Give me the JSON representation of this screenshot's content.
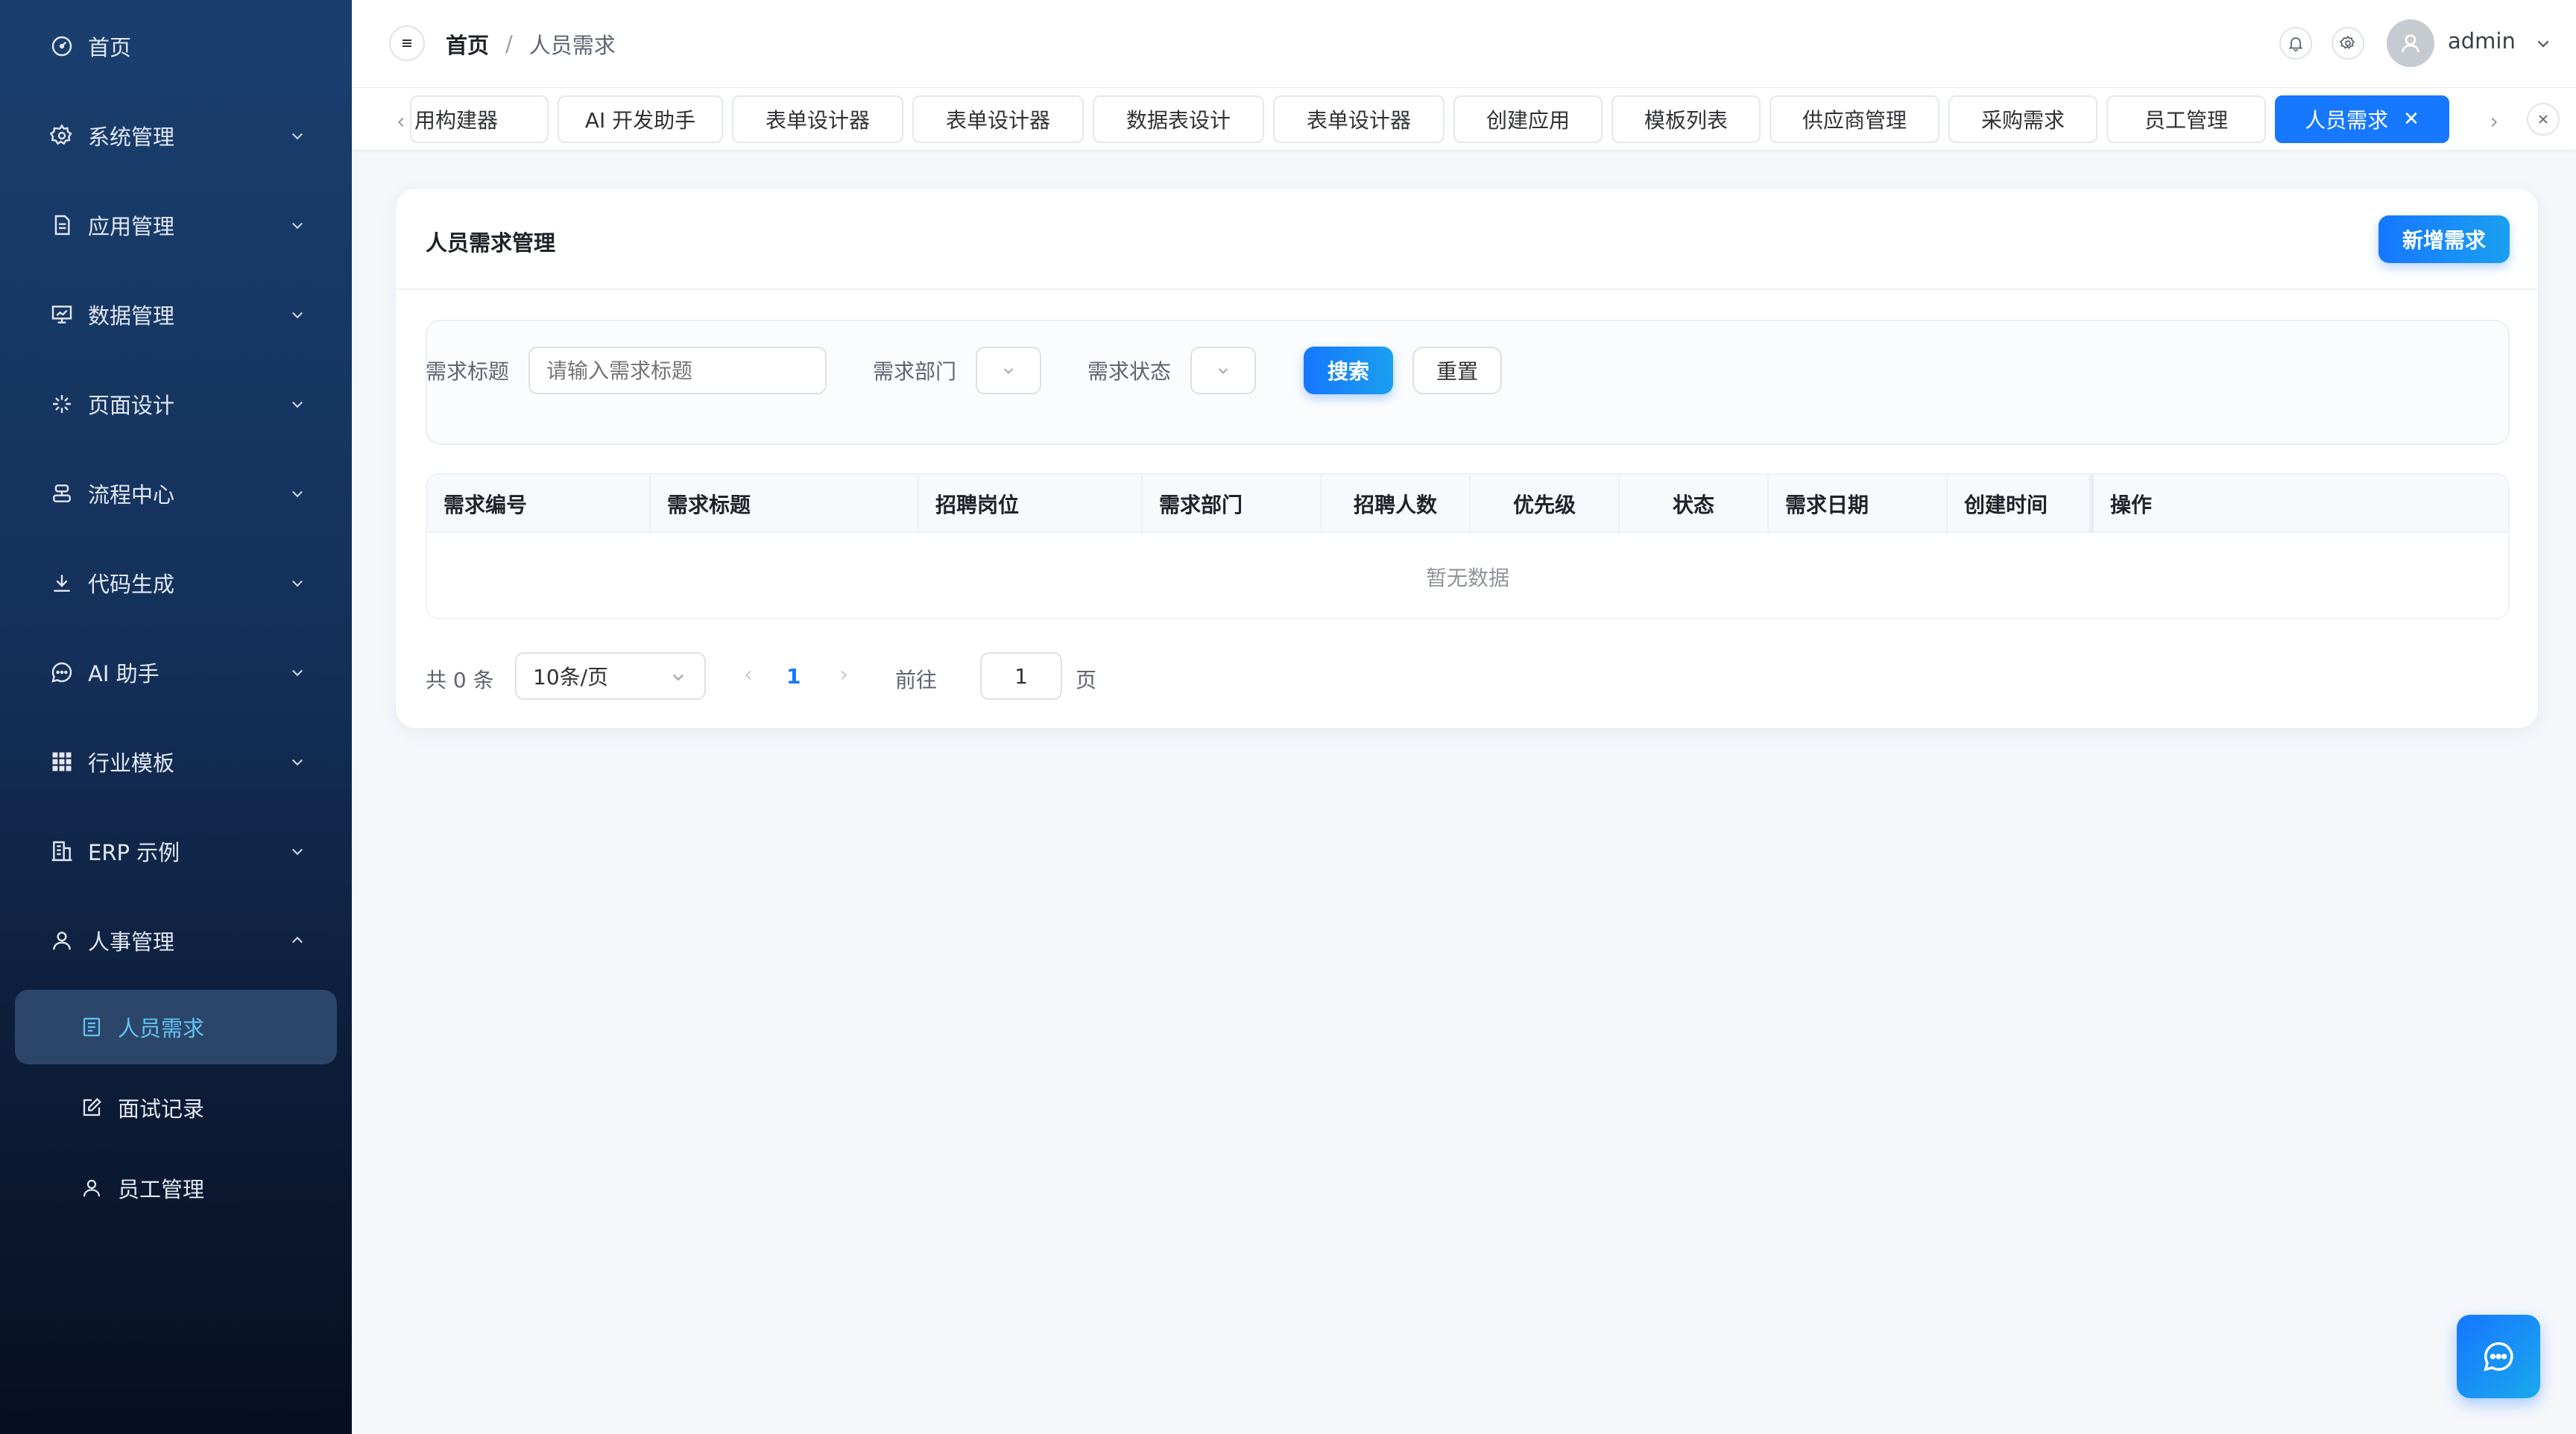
{
  "sidebar": {
    "items": [
      {
        "label": "首页",
        "icon": "dashboard-icon"
      },
      {
        "label": "系统管理",
        "icon": "gear-icon"
      },
      {
        "label": "应用管理",
        "icon": "document-icon"
      },
      {
        "label": "数据管理",
        "icon": "chart-board-icon"
      },
      {
        "label": "页面设计",
        "icon": "sparkle-icon"
      },
      {
        "label": "流程中心",
        "icon": "flow-icon"
      },
      {
        "label": "代码生成",
        "icon": "download-icon"
      },
      {
        "label": "AI 助手",
        "icon": "chat-bubble-icon"
      },
      {
        "label": "行业模板",
        "icon": "grid-icon"
      },
      {
        "label": "ERP 示例",
        "icon": "building-icon"
      },
      {
        "label": "人事管理",
        "icon": "user-icon"
      }
    ],
    "sub_items": [
      {
        "label": "人员需求",
        "icon": "list-doc-icon",
        "active": true
      },
      {
        "label": "面试记录",
        "icon": "edit-icon",
        "active": false
      },
      {
        "label": "员工管理",
        "icon": "user-icon",
        "active": false
      }
    ]
  },
  "header": {
    "breadcrumb": {
      "home": "首页",
      "separator": "/",
      "current": "人员需求"
    },
    "user_name": "admin"
  },
  "tabs": [
    {
      "label": "用构建器"
    },
    {
      "label": "AI 开发助手"
    },
    {
      "label": "表单设计器"
    },
    {
      "label": "表单设计器"
    },
    {
      "label": "数据表设计"
    },
    {
      "label": "表单设计器"
    },
    {
      "label": "创建应用"
    },
    {
      "label": "模板列表"
    },
    {
      "label": "供应商管理"
    },
    {
      "label": "采购需求"
    },
    {
      "label": "员工管理"
    },
    {
      "label": "人员需求",
      "active": true,
      "close": "✕"
    }
  ],
  "card": {
    "title": "人员需求管理",
    "add_button": "新增需求"
  },
  "search": {
    "title_label": "需求标题",
    "title_placeholder": "请输入需求标题",
    "dept_label": "需求部门",
    "status_label": "需求状态",
    "search_button": "搜索",
    "reset_button": "重置"
  },
  "table": {
    "columns": [
      "需求编号",
      "需求标题",
      "招聘岗位",
      "需求部门",
      "招聘人数",
      "优先级",
      "状态",
      "需求日期",
      "创建时间",
      "操作"
    ],
    "empty_text": "暂无数据"
  },
  "pagination": {
    "total": "共 0 条",
    "page_size": "10条/页",
    "current_page": "1",
    "goto_label": "前往",
    "goto_value": "1",
    "page_suffix": "页"
  },
  "colors": {
    "accent": "#1677ff",
    "sidebar_top": "#1a3f6f",
    "sidebar_bottom": "#070f22",
    "active_sub_text": "#62c3f5"
  }
}
